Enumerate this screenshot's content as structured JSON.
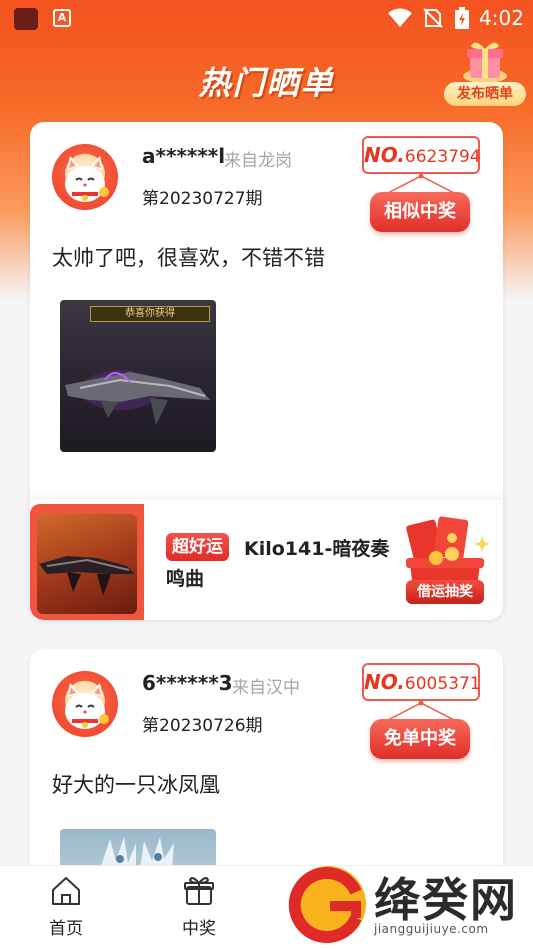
{
  "status_bar": {
    "time": "4:02",
    "app2_label": "A",
    "icons": [
      "app-icon",
      "app-icon",
      "wifi-icon",
      "no-sim-icon",
      "battery-charging-icon"
    ]
  },
  "header": {
    "title": "热门晒单",
    "publish_label": "发布晒单",
    "publish_icon": "gift-box-icon"
  },
  "posts": [
    {
      "username": "a******l",
      "location": "来自龙岗",
      "period": "第20230727期",
      "no_prefix": "NO.",
      "no_number": "6623794",
      "tag": "相似中奖",
      "comment": "太帅了吧，很喜欢，不错不错",
      "photo_banner": "恭喜你获得",
      "prize": {
        "badge": "超好运",
        "name": "Kilo141-暗夜奏鸣曲",
        "action": "借运抽奖"
      }
    },
    {
      "username": "6******3",
      "location": "来自汉中",
      "period": "第20230726期",
      "no_prefix": "NO.",
      "no_number": "6005371",
      "tag": "免单中奖",
      "comment": "好大的一只冰凤凰"
    }
  ],
  "bottom_nav": {
    "items": [
      {
        "label": "首页",
        "icon": "home-icon"
      },
      {
        "label": "中奖",
        "icon": "gift-icon"
      }
    ]
  },
  "watermark": {
    "text": "绛癸网",
    "url": "jiangguijiuye.com"
  },
  "colors": {
    "primary": "#f4521f",
    "accent_red": "#e12e2a",
    "text": "#222222",
    "muted": "#a6a6a6"
  }
}
